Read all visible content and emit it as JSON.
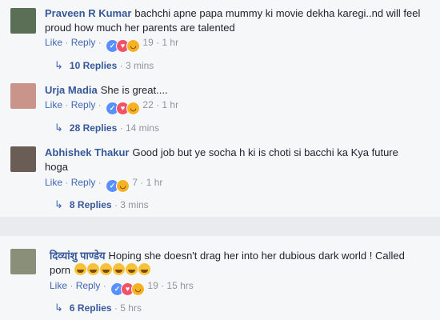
{
  "comments": [
    {
      "author": "Praveen R Kumar",
      "text": "bachchi apne papa mummy ki movie dekha karegi..nd will feel proud how much her parents are talented",
      "like": "Like",
      "reply": "Reply",
      "reaction_count": "19",
      "time": "1 hr",
      "replies": "10 Replies",
      "replies_time": "3 mins",
      "avatar_color": "#5b6f57"
    },
    {
      "author": "Urja Madia",
      "text": "She is great....",
      "like": "Like",
      "reply": "Reply",
      "reaction_count": "22",
      "time": "1 hr",
      "replies": "28 Replies",
      "replies_time": "14 mins",
      "avatar_color": "#c9958a"
    },
    {
      "author": "Abhishek Thakur",
      "text": "Good job but ye socha h ki is choti si bacchi ka Kya future hoga",
      "like": "Like",
      "reply": "Reply",
      "reaction_count": "7",
      "time": "1 hr",
      "replies": "8 Replies",
      "replies_time": "3 mins",
      "avatar_color": "#6a5d55"
    },
    {
      "author": "दिव्यांशु पाण्डेय",
      "text": "Hoping she doesn't drag her into her dubious dark world ! Called porn",
      "like": "Like",
      "reply": "Reply",
      "reaction_count": "19",
      "time": "15 hrs",
      "replies": "6 Replies",
      "replies_time": "5 hrs",
      "avatar_color": "#8a8f7a"
    }
  ],
  "separator": " · ",
  "reply_arrow": "↳"
}
